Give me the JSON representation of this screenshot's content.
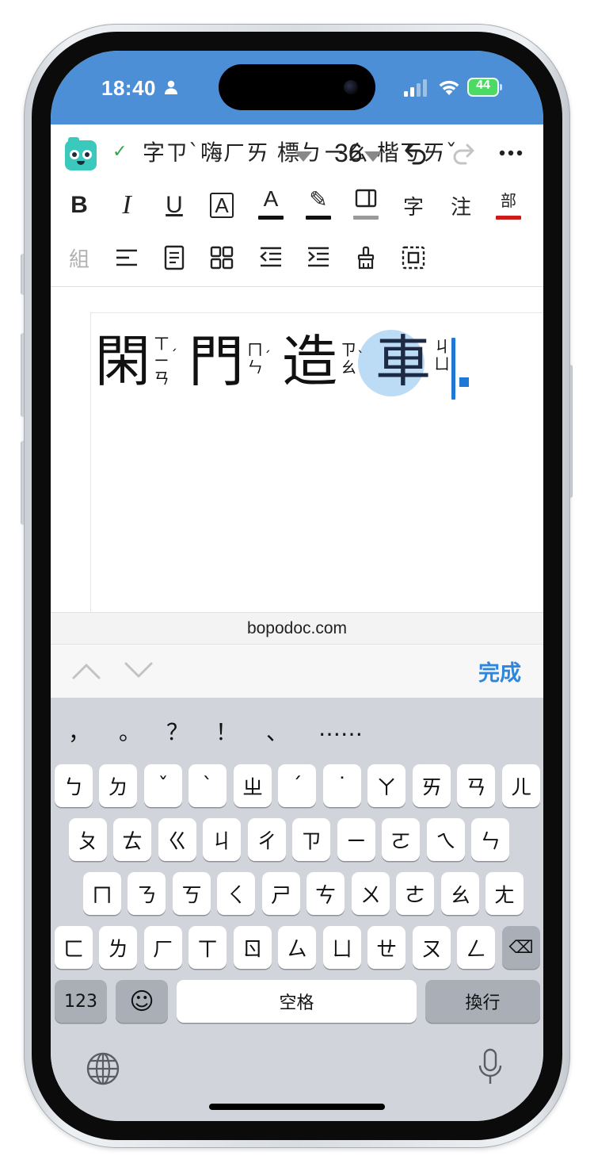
{
  "status_bar": {
    "time": "18:40",
    "battery": "44",
    "bg_color": "#4c8fd6",
    "icons": [
      "person-icon",
      "signal-icon",
      "wifi-icon",
      "battery-charging-icon"
    ]
  },
  "toolbar": {
    "saved_check": "✓",
    "font_sample": "字ㄗˋ嗨ㄏㄞ 標ㄅㄧㄠ 楷ㄎㄞˇ",
    "font_size": "36",
    "row2": [
      "B",
      "I",
      "U",
      "A",
      "A",
      "✎",
      "▭",
      "字",
      "注",
      "部"
    ],
    "row3_first": "組",
    "underline_colors": {
      "text_color": "#111111",
      "highlight": "#111111",
      "border": "#9a9a9a",
      "radical": "#cc1b1b"
    }
  },
  "document": {
    "chars": [
      {
        "han": "閑",
        "zhuyin": [
          "ㄒ",
          "ㄧ",
          "ㄢ"
        ],
        "tone": "ˊ"
      },
      {
        "han": "門",
        "zhuyin": [
          "ㄇ",
          "ㄣ"
        ],
        "tone": "ˊ"
      },
      {
        "han": "造",
        "zhuyin": [
          "ㄗ",
          "ㄠ"
        ],
        "tone": "ˋ"
      },
      {
        "han": "車",
        "zhuyin": [
          "ㄐ",
          "ㄩ"
        ],
        "tone": ""
      }
    ],
    "selection_color": "#bcdcf6",
    "caret_color": "#1f77d6"
  },
  "url_bar": {
    "url": "bopodoc.com"
  },
  "accessory": {
    "done_label": "完成",
    "done_color": "#2f86dd"
  },
  "keyboard": {
    "punctuation": [
      "，",
      "。",
      "？",
      "！",
      "、",
      "……"
    ],
    "rows": [
      [
        "ㄅ",
        "ㄉ",
        "ˇ",
        "ˋ",
        "ㄓ",
        "ˊ",
        "˙",
        "ㄚ",
        "ㄞ",
        "ㄢ",
        "ㄦ"
      ],
      [
        "ㄆ",
        "ㄊ",
        "ㄍ",
        "ㄐ",
        "ㄔ",
        "ㄗ",
        "ㄧ",
        "ㄛ",
        "ㄟ",
        "ㄣ"
      ],
      [
        "ㄇ",
        "ㄋ",
        "ㄎ",
        "ㄑ",
        "ㄕ",
        "ㄘ",
        "ㄨ",
        "ㄜ",
        "ㄠ",
        "ㄤ"
      ],
      [
        "ㄈ",
        "ㄌ",
        "ㄏ",
        "ㄒ",
        "ㄖ",
        "ㄙ",
        "ㄩ",
        "ㄝ",
        "ㄡ",
        "ㄥ"
      ]
    ],
    "numbers_label": "123",
    "space_label": "空格",
    "return_label": "換行",
    "emoji": "☺",
    "backspace": "⌫"
  }
}
